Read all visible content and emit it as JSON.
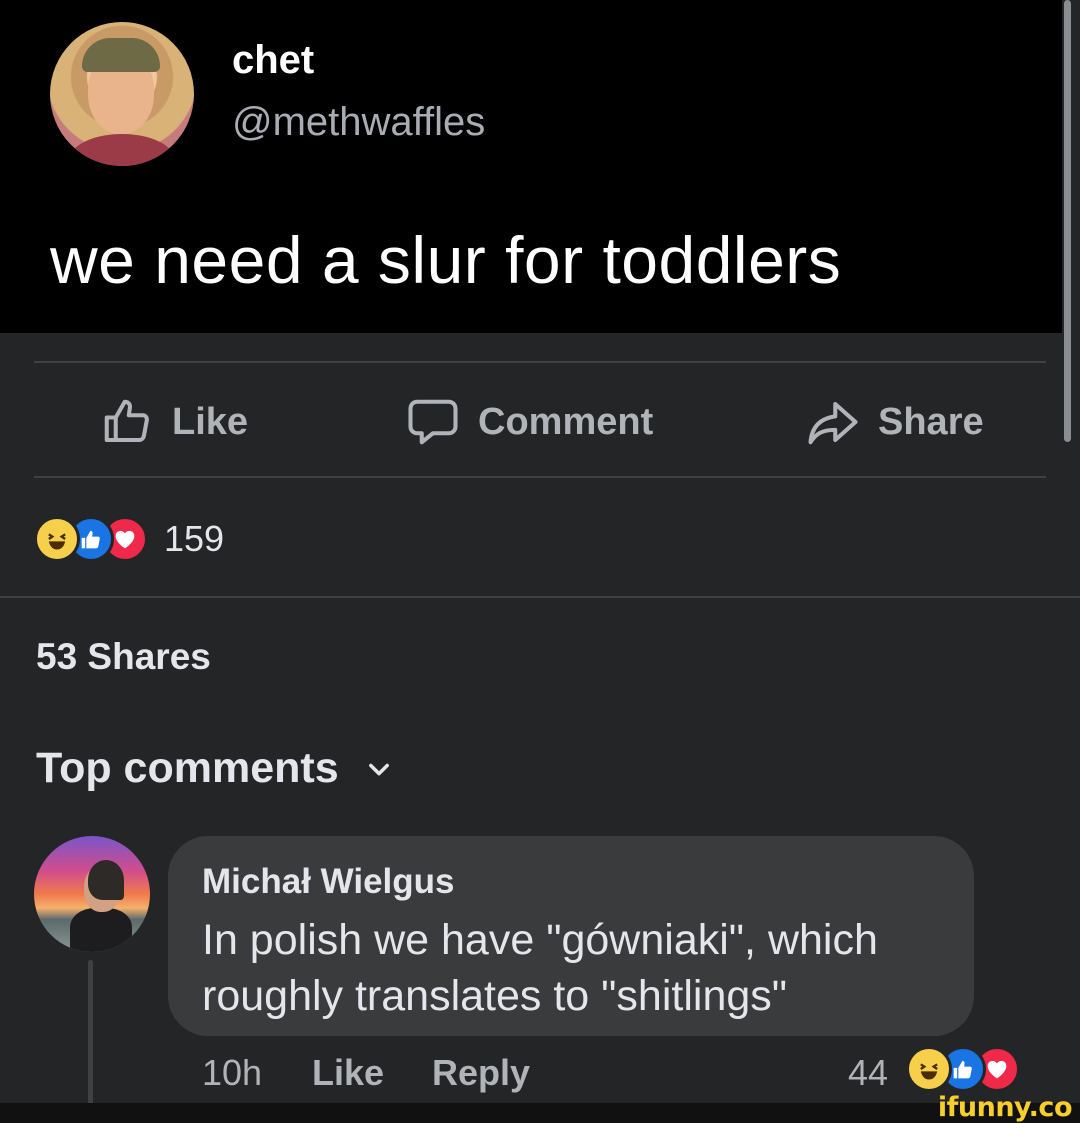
{
  "tweet": {
    "name": "chet",
    "handle": "@methwaffles",
    "text": "we need a slur for toddlers"
  },
  "actions": {
    "like": "Like",
    "comment": "Comment",
    "share": "Share"
  },
  "reactions": {
    "types": [
      "haha",
      "like",
      "love"
    ],
    "count": "159"
  },
  "shares_text": "53 Shares",
  "top_comments_label": "Top comments",
  "comment": {
    "author": "Michał Wielgus",
    "text": "In polish we have \"gówniaki\", which roughly translates to \"shitlings\"",
    "time": "10h",
    "like_label": "Like",
    "reply_label": "Reply",
    "reaction_count": "44",
    "reaction_types": [
      "haha",
      "like",
      "love"
    ]
  },
  "watermark": "ifunny.co",
  "colors": {
    "background": "#242526",
    "tweet_background": "#000000",
    "bubble": "#3a3b3c",
    "like_blue": "#1b74e4",
    "love_red": "#f0284a",
    "haha_yellow": "#f7d04b",
    "watermark_yellow": "#f7ce2b"
  }
}
